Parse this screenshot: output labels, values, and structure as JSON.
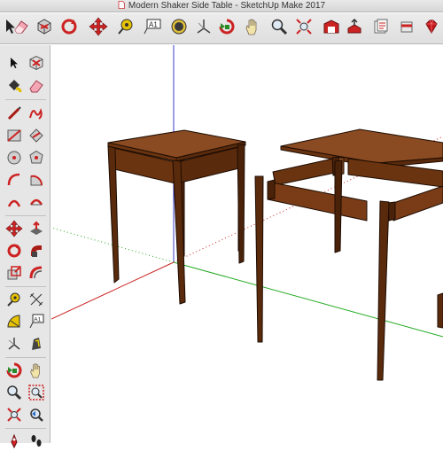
{
  "window": {
    "title": "Modern Shaker Side Table - SketchUp Make 2017"
  },
  "toolbar": {
    "items": [
      {
        "name": "select-tool-icon"
      },
      {
        "name": "eraser-icon"
      },
      {
        "name": "make-component-icon"
      },
      {
        "name": "rotate-icon"
      },
      {
        "name": "move-icon"
      },
      {
        "name": "tape-measure-icon"
      },
      {
        "name": "text-icon"
      },
      {
        "name": "paint-bucket-icon"
      },
      {
        "name": "axes-icon"
      },
      {
        "name": "orbit-icon"
      },
      {
        "name": "pan-icon"
      },
      {
        "name": "zoom-icon"
      },
      {
        "name": "zoom-extents-icon"
      },
      {
        "name": "warehouse-icon"
      },
      {
        "name": "share-model-icon"
      },
      {
        "name": "layout-icon"
      },
      {
        "name": "extension-warehouse-icon"
      },
      {
        "name": "ruby-icon"
      }
    ],
    "text_tool_glyph": "A1"
  },
  "tool_palette": {
    "text_tool_glyph": "A1",
    "tools": [
      "select-icon",
      "make-component-icon",
      "paint-bucket-icon",
      "eraser-icon",
      "line-icon",
      "freehand-icon",
      "rectangle-icon",
      "rotated-rectangle-icon",
      "circle-icon",
      "polygon-icon",
      "arc-icon",
      "pie-icon",
      "three-point-arc-icon",
      "two-point-arc-icon",
      "move-icon",
      "push-pull-icon",
      "rotate-icon",
      "follow-me-icon",
      "scale-icon",
      "offset-icon",
      "tape-measure-icon",
      "dimension-icon",
      "protractor-icon",
      "text-icon",
      "axes-icon",
      "section-plane-icon",
      "orbit-icon",
      "pan-icon",
      "zoom-icon",
      "zoom-window-icon",
      "zoom-extents-icon",
      "previous-view-icon",
      "position-camera-icon",
      "walk-icon"
    ]
  },
  "colors": {
    "wood_top": "#8a4b22",
    "wood_front": "#6b3410",
    "wood_dark": "#4a220a",
    "axis_blue": "#3b3bcc",
    "axis_red": "#cc2222",
    "axis_green": "#22aa22",
    "tool_red": "#cc2a1a"
  }
}
